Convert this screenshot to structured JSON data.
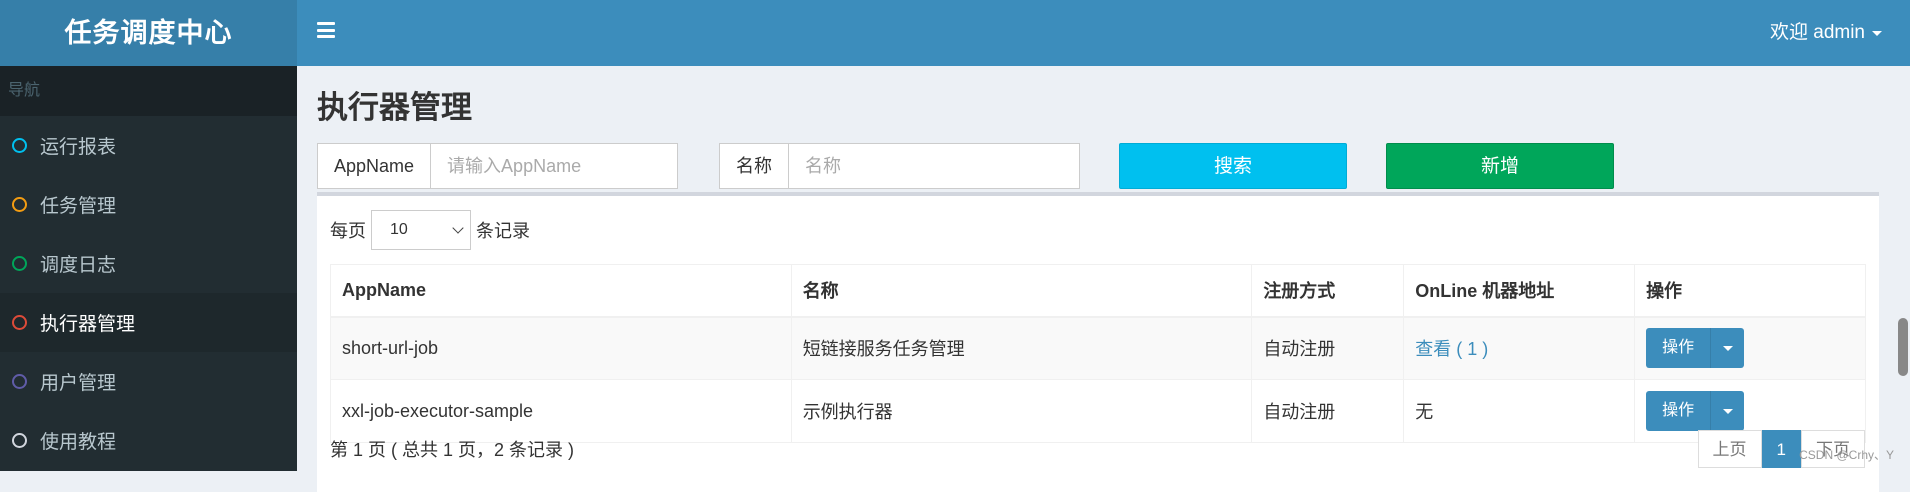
{
  "sidebar": {
    "brand": "任务调度中心",
    "header": "导航",
    "items": [
      {
        "label": "运行报表",
        "color": "#00c0ef"
      },
      {
        "label": "任务管理",
        "color": "#f39c12"
      },
      {
        "label": "调度日志",
        "color": "#00a65a"
      },
      {
        "label": "执行器管理",
        "color": "#dd4b39"
      },
      {
        "label": "用户管理",
        "color": "#605ca8"
      },
      {
        "label": "使用教程",
        "color": "#d2d6de"
      }
    ]
  },
  "header": {
    "user_label": "欢迎 admin"
  },
  "main": {
    "title": "执行器管理",
    "search": {
      "appname_label": "AppName",
      "appname_placeholder": "请输入AppName",
      "name_label": "名称",
      "name_placeholder": "名称",
      "search_button": "搜索",
      "add_button": "新增"
    },
    "length": {
      "prefix": "每页",
      "value": "10",
      "suffix": "条记录"
    },
    "table": {
      "columns": [
        "AppName",
        "名称",
        "注册方式",
        "OnLine 机器地址",
        "操作"
      ],
      "rows": [
        {
          "appname": "short-url-job",
          "name": "短链接服务任务管理",
          "reg": "自动注册",
          "online": "查看 ( 1 )",
          "op": "操作"
        },
        {
          "appname": "xxl-job-executor-sample",
          "name": "示例执行器",
          "reg": "自动注册",
          "online": "无",
          "op": "操作"
        }
      ]
    },
    "info": "第 1 页 ( 总共 1 页，2 条记录 )",
    "pager": {
      "prev": "上页",
      "current": "1",
      "next": "下页"
    }
  },
  "watermark": "CSDN @Crhy、Y",
  "colors": {
    "brand_bg": "#367fa9",
    "header_bg": "#3c8dbc",
    "sidebar_bg": "#222d32",
    "search_btn": "#00c0ef",
    "add_btn": "#00a65a"
  }
}
